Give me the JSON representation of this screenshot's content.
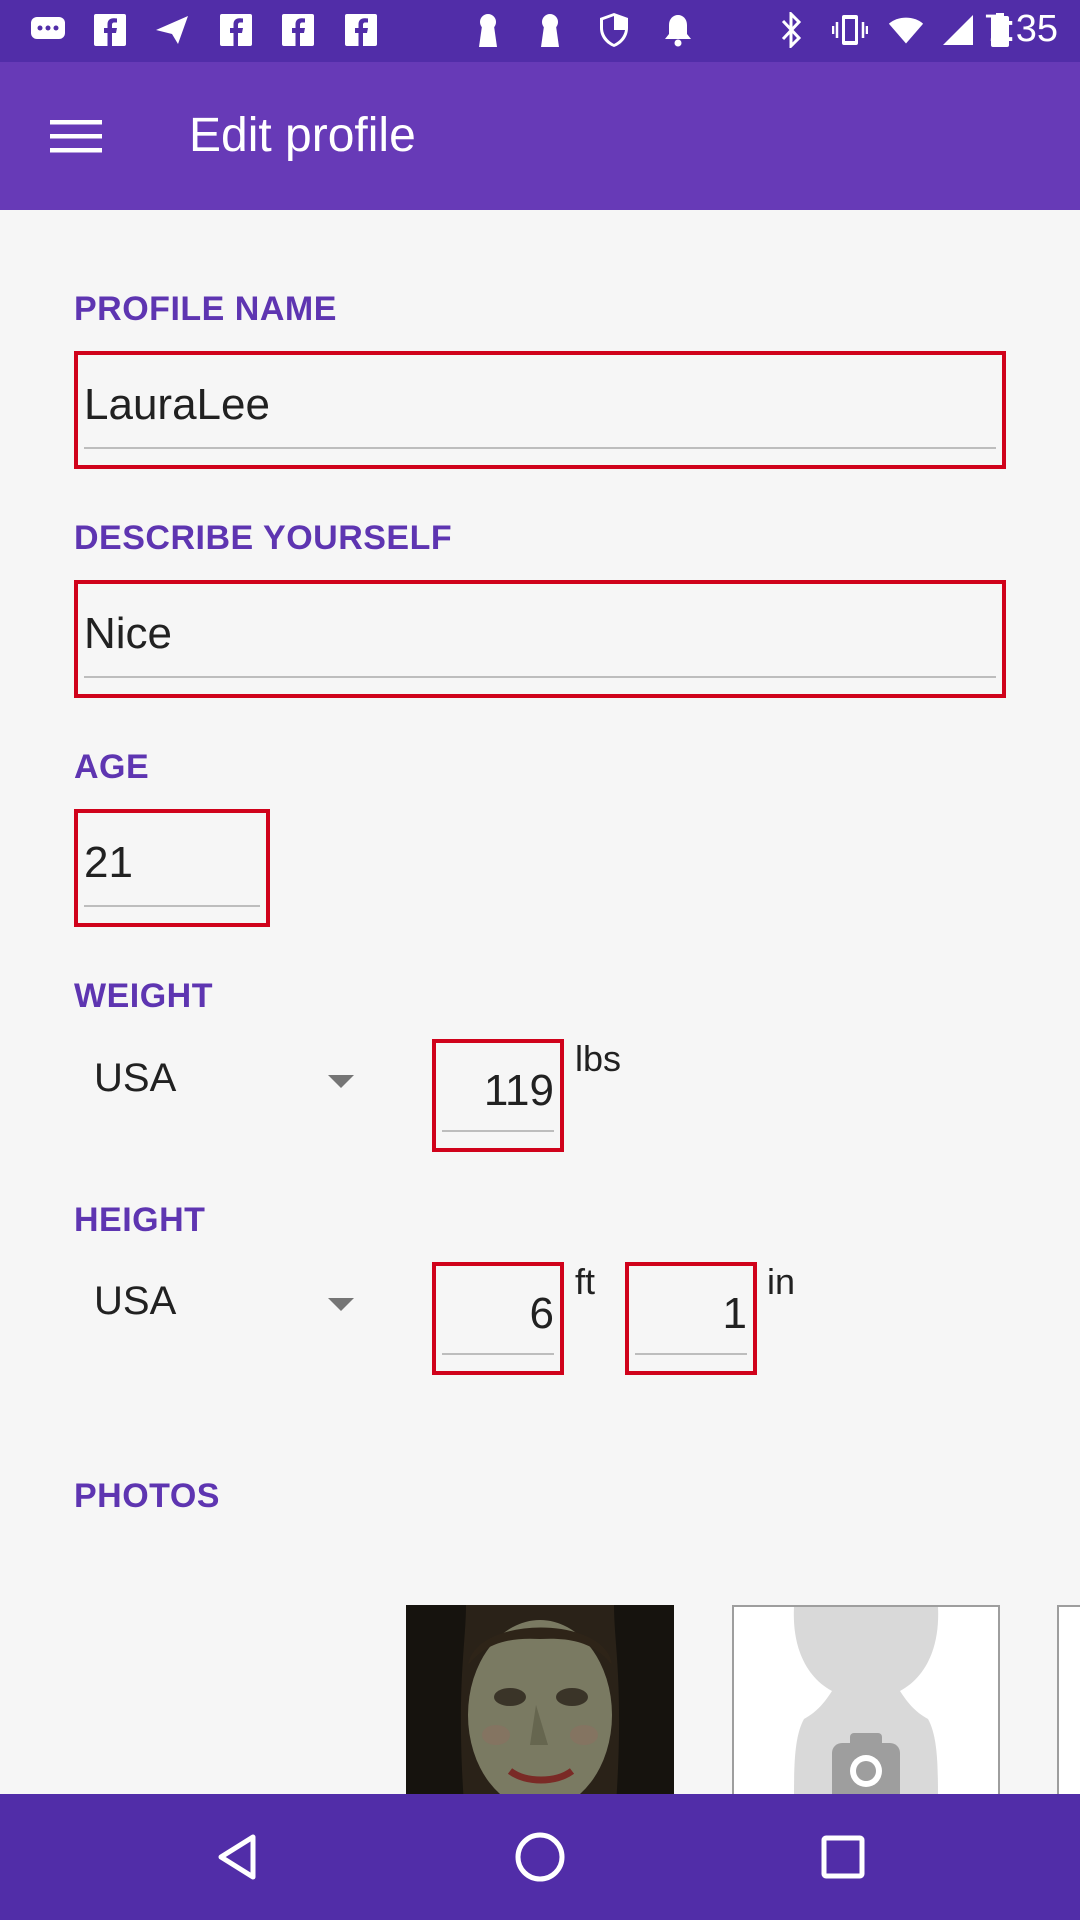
{
  "status_bar": {
    "time": "7:35",
    "left_icons": [
      "chat-icon",
      "facebook-icon",
      "send-icon",
      "facebook-icon",
      "facebook-icon",
      "facebook-icon",
      "keyhole-icon",
      "keyhole-icon",
      "shield-icon",
      "bell-icon"
    ],
    "right_icons": [
      "bluetooth-icon",
      "vibrate-icon",
      "wifi-icon",
      "signal-icon",
      "battery-icon"
    ]
  },
  "app_bar": {
    "title": "Edit profile",
    "menu_icon": "menu-icon"
  },
  "profile_name": {
    "label": "PROFILE NAME",
    "value": "LauraLee"
  },
  "describe": {
    "label": "DESCRIBE YOURSELF",
    "value": "Nice"
  },
  "age": {
    "label": "AGE",
    "value": "21"
  },
  "weight": {
    "label": "WEIGHT",
    "system": "USA",
    "value": "119",
    "unit": "lbs"
  },
  "height": {
    "label": "HEIGHT",
    "system": "USA",
    "feet": "6",
    "feet_unit": "ft",
    "inches": "1",
    "inches_unit": "in"
  },
  "photos": {
    "label": "PHOTOS"
  },
  "nav_bar": {
    "buttons": [
      "back-icon",
      "home-icon",
      "recents-icon"
    ]
  },
  "colors": {
    "status_bar": "#512DA8",
    "app_bar": "#673AB7",
    "label": "#5E35B1",
    "highlight_border": "#D0021B",
    "background": "#F6F6F6"
  }
}
